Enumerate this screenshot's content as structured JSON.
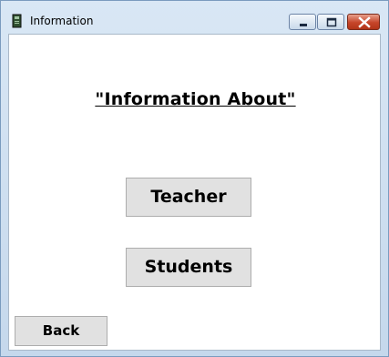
{
  "window": {
    "title": "Information"
  },
  "main": {
    "heading": "\"Information About\"",
    "teacher_label": "Teacher",
    "students_label": "Students",
    "back_label": "Back"
  },
  "icons": {
    "app": "book-icon",
    "minimize": "minimize-icon",
    "maximize": "maximize-icon",
    "close": "close-icon"
  },
  "colors": {
    "close_button": "#c6452a",
    "button_face": "#e1e1e1",
    "title_bar": "#d9e7f5"
  }
}
